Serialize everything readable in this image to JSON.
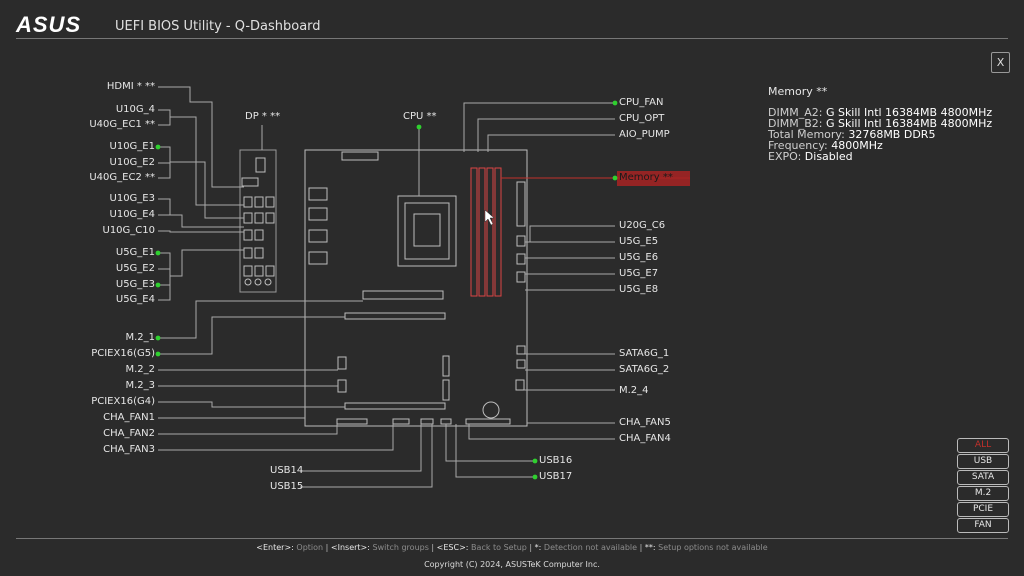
{
  "header": {
    "logo": "ASUS",
    "title": "UEFI BIOS Utility - Q-Dashboard",
    "close": "X"
  },
  "left_labels": [
    "HDMI * **",
    "U10G_4",
    "U40G_EC1 **",
    "U10G_E1",
    "U10G_E2",
    "U40G_EC2 **",
    "U10G_E3",
    "U10G_E4",
    "U10G_C10",
    "U5G_E1",
    "U5G_E2",
    "U5G_E3",
    "U5G_E4",
    "M.2_1",
    "PCIEX16(G5)",
    "M.2_2",
    "M.2_3",
    "PCIEX16(G4)",
    "CHA_FAN1",
    "CHA_FAN2",
    "CHA_FAN3"
  ],
  "top_labels": {
    "dp": "DP * **",
    "cpu": "CPU **"
  },
  "right_labels": [
    "CPU_FAN",
    "CPU_OPT",
    "AIO_PUMP",
    "Memory **",
    "U20G_C6",
    "U5G_E5",
    "U5G_E6",
    "U5G_E7",
    "U5G_E8",
    "SATA6G_1",
    "SATA6G_2",
    "M.2_4",
    "CHA_FAN5",
    "CHA_FAN4"
  ],
  "bottom_labels": [
    "USB14",
    "USB15",
    "USB16",
    "USB17"
  ],
  "detail": {
    "title": "Memory **",
    "rows": [
      {
        "k": "DIMM_A2:",
        "v": "G Skill Intl 16384MB 4800MHz"
      },
      {
        "k": "DIMM_B2:",
        "v": "G Skill Intl 16384MB 4800MHz"
      },
      {
        "k": "Total Memory:",
        "v": "32768MB DDR5"
      },
      {
        "k": "Frequency:",
        "v": "4800MHz"
      },
      {
        "k": "EXPO:",
        "v": "Disabled"
      }
    ]
  },
  "filters": [
    "ALL",
    "USB",
    "SATA",
    "M.2",
    "PCIE",
    "FAN"
  ],
  "footer": {
    "items": [
      {
        "k": "<Enter>:",
        "d": "Option"
      },
      {
        "k": "<Insert>:",
        "d": "Switch groups"
      },
      {
        "k": "<ESC>:",
        "d": "Back to Setup"
      },
      {
        "k": "*:",
        "d": "Detection not available"
      },
      {
        "k": "**:",
        "d": "Setup options not available"
      }
    ],
    "copyright": "Copyright (C) 2024, ASUSTeK Computer Inc."
  },
  "colors": {
    "accent_red": "#c0302b",
    "connected_green": "#2fd02f",
    "background": "#2b2b2b"
  },
  "connected": [
    "U10G_E1",
    "U5G_E1",
    "U5G_E3",
    "M.2_1",
    "PCIEX16(G5)",
    "CPU **",
    "CPU_FAN",
    "Memory **",
    "USB16",
    "USB17"
  ]
}
